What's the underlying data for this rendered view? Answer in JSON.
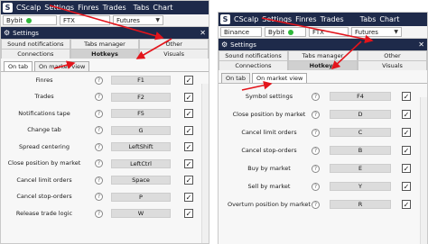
{
  "left": {
    "app_name": "CScalp",
    "menu": [
      "Settings",
      "Finres",
      "Trades",
      "Tabs",
      "Chart"
    ],
    "menu_extra": "",
    "exchange": "Bybit",
    "ftx": "FTX",
    "futures": "Futures",
    "settings_title": "Settings",
    "tabs_row1": [
      "Sound notifications",
      "Tabs manager",
      "Other"
    ],
    "tabs_row2": [
      "Connections",
      "Hotkeys",
      "Visuals"
    ],
    "subtabs": [
      "On tab",
      "On market view"
    ],
    "rows": [
      {
        "label": "Finres",
        "key": "F1",
        "checked": true
      },
      {
        "label": "Trades",
        "key": "F2",
        "checked": true
      },
      {
        "label": "Notifications tape",
        "key": "F5",
        "checked": true
      },
      {
        "label": "Change tab",
        "key": "G",
        "checked": true
      },
      {
        "label": "Spread centering",
        "key": "LeftShift",
        "checked": true
      },
      {
        "label": "Close position by market",
        "key": "LeftCtrl",
        "checked": true
      },
      {
        "label": "Cancel limit orders",
        "key": "Space",
        "checked": true
      },
      {
        "label": "Cancel stop-orders",
        "key": "P",
        "checked": true
      },
      {
        "label": "Release trade logic",
        "key": "W",
        "checked": true
      }
    ]
  },
  "right": {
    "app_name": "CScalp",
    "menu": [
      "Settings",
      "Finres",
      "Trades",
      "Tabs",
      "Chart"
    ],
    "exchange": "Binance",
    "exchange2": "Bybit",
    "ftx": "FTX",
    "futures": "Futures",
    "settings_title": "Settings",
    "tabs_row1": [
      "Sound notifications",
      "Tabs manager",
      "Other"
    ],
    "tabs_row2": [
      "Connections",
      "Hotkeys",
      "Visuals"
    ],
    "subtabs": [
      "On tab",
      "On market view"
    ],
    "rows": [
      {
        "label": "Symbol settings",
        "key": "F4",
        "checked": true
      },
      {
        "label": "Close position by market",
        "key": "D",
        "checked": true
      },
      {
        "label": "Cancel limit orders",
        "key": "C",
        "checked": true
      },
      {
        "label": "Cancel stop-orders",
        "key": "B",
        "checked": true
      },
      {
        "label": "Buy by market",
        "key": "E",
        "checked": true
      },
      {
        "label": "Sell by market",
        "key": "Y",
        "checked": true
      },
      {
        "label": "Overturn position by market",
        "key": "R",
        "checked": true
      }
    ]
  },
  "icons": {
    "help": "question-icon",
    "check": "checkmark-icon",
    "close": "close-icon",
    "settings": "gear-icon",
    "dropdown": "chevron-down-icon"
  },
  "colors": {
    "titlebar": "#1e2a4a",
    "annotation_arrow": "#e3141b",
    "status_dot": "#2fb83a"
  }
}
